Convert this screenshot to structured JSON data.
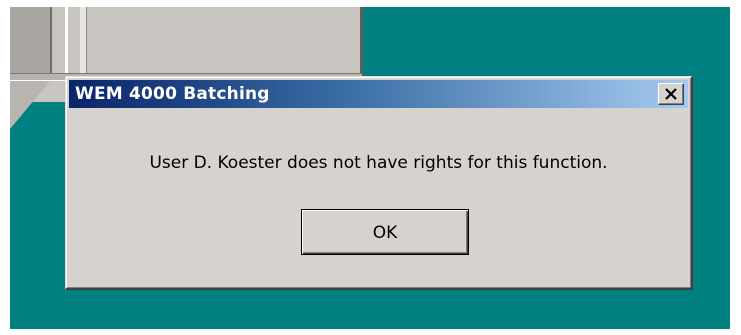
{
  "dialog": {
    "title": "WEM 4000 Batching",
    "message": "User D. Koester does not have rights for this function.",
    "ok_label": "OK",
    "close_icon": "close-icon"
  },
  "colors": {
    "desktop": "#008080",
    "titlebar_start": "#0a246a",
    "titlebar_end": "#a6caf0",
    "dialog_face": "#d6d3ce"
  }
}
